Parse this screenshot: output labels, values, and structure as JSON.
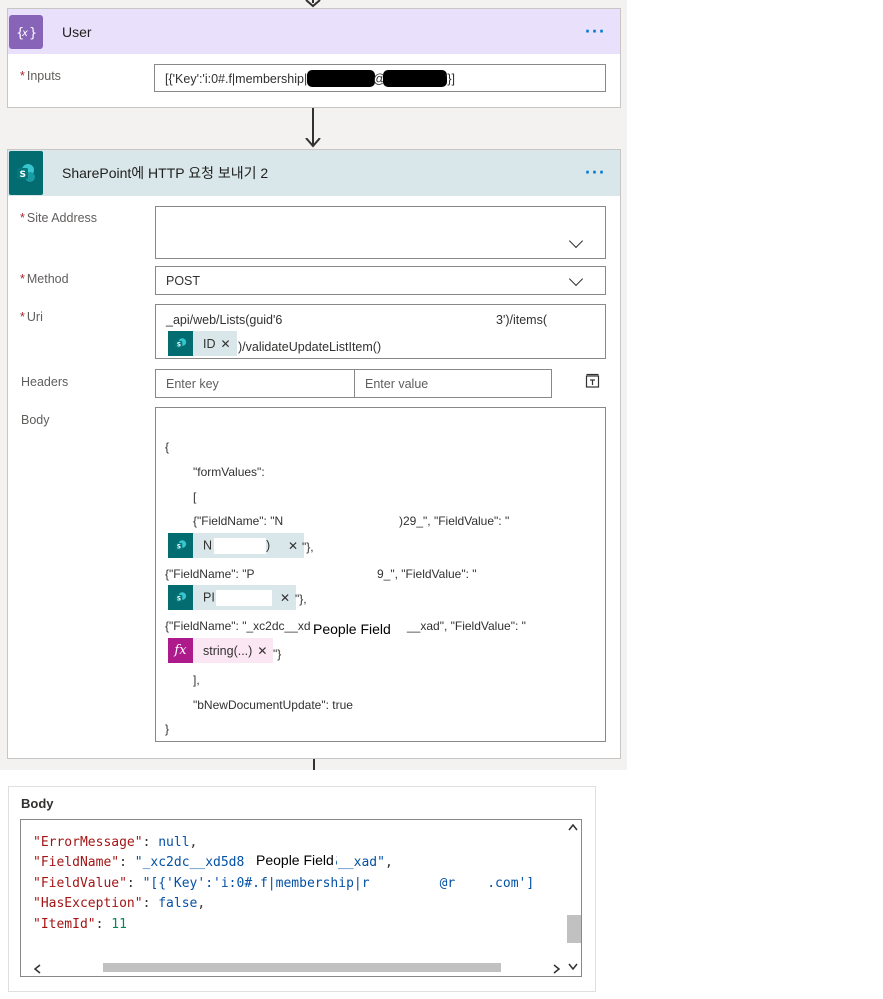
{
  "user_card": {
    "title": "User",
    "more": "···",
    "inputs_label": "Inputs",
    "inputs_value_prefix": "[{'Key':'i:0#.f|membership|",
    "inputs_value_mid": "@",
    "inputs_value_suffix": "'}]"
  },
  "http_card": {
    "title": "SharePoint에 HTTP 요청 보내기 2",
    "more": "···",
    "site_address_label": "Site Address",
    "method_label": "Method",
    "method_value": "POST",
    "uri_label": "Uri",
    "uri_line1_a": "_api/web/Lists(guid'6",
    "uri_line1_b": "3')/items(",
    "uri_token": "ID",
    "uri_line2": ")/validateUpdateListItem()",
    "headers_label": "Headers",
    "header_key_placeholder": "Enter key",
    "header_value_placeholder": "Enter value",
    "body_label": "Body",
    "body": {
      "open": "{",
      "form_values": "\"formValues\":",
      "bracket_open": "[",
      "f1_a": "{\"FieldName\": \"N",
      "f1_b": ")29_\", \"FieldValue\": \"",
      "f1_token": "N",
      "f1_token_end": ")",
      "f1_close": "\"},",
      "f2_a": "{\"FieldName\": \"P",
      "f2_b": "9_\", \"FieldValue\": \"",
      "f2_token": "PI",
      "f2_close": "\"},",
      "f3_a": "{\"FieldName\": \"_xc2dc__xd5",
      "f3_overlay": "People Field",
      "f3_b": "__xad\", \"FieldValue\": \"",
      "f3_token": "string(...)",
      "f3_close": "\"}",
      "bracket_close": "],",
      "new_doc": "\"bNewDocumentUpdate\": true",
      "close": "}"
    }
  },
  "output": {
    "label": "Body",
    "lines": [
      {
        "key": "\"ErrorMessage\"",
        "sep": ": ",
        "value": "null",
        "tail": ",",
        "type": "s"
      },
      {
        "key": "\"FieldName\"",
        "sep": ": ",
        "value": "\"_xc2dc__xd5d8",
        "value2": "c5__xad\"",
        "tail": ",",
        "type": "s"
      },
      {
        "key": "\"FieldValue\"",
        "sep": ": ",
        "value": "\"[{'Key':'i:0#.f|membership|r",
        "value2": "@r",
        "value3": ".com']",
        "tail": "",
        "type": "s"
      },
      {
        "key": "\"HasException\"",
        "sep": ": ",
        "value": "false",
        "tail": ",",
        "type": "s"
      },
      {
        "key": "\"ItemId\"",
        "sep": ": ",
        "value": "11",
        "tail": "",
        "type": "n"
      }
    ],
    "overlay": "People Field"
  },
  "colors": {
    "variable_header": "#e9e1fb",
    "variable_icon": "#8764b8",
    "sharepoint_header": "#d9e7ea",
    "sharepoint_icon": "#036c70",
    "expression_token": "#fbe6f4",
    "expression_icon": "#ad1a8c"
  },
  "icons": {
    "variable": "curly-braces-icon",
    "sharepoint": "sharepoint-icon",
    "expression": "fx-icon",
    "headers_toggle": "text-mode-icon"
  }
}
